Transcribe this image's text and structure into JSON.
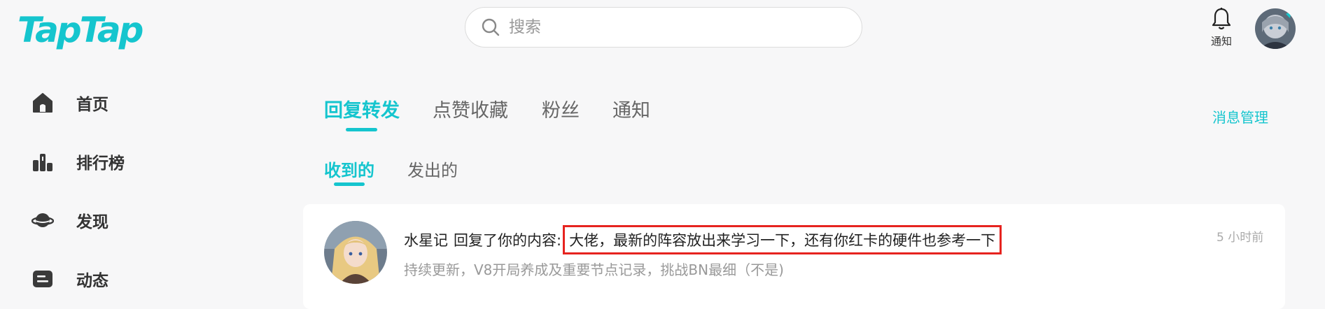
{
  "header": {
    "logo_text": "TapTap",
    "search_placeholder": "搜索",
    "notify_label": "通知"
  },
  "sidebar": {
    "items": [
      {
        "label": "首页",
        "icon": "home-icon"
      },
      {
        "label": "排行榜",
        "icon": "ranking-icon"
      },
      {
        "label": "发现",
        "icon": "planet-icon"
      },
      {
        "label": "动态",
        "icon": "feed-icon"
      }
    ]
  },
  "tabs": [
    {
      "label": "回复转发",
      "active": true
    },
    {
      "label": "点赞收藏",
      "active": false
    },
    {
      "label": "粉丝",
      "active": false
    },
    {
      "label": "通知",
      "active": false
    }
  ],
  "manage_label": "消息管理",
  "subtabs": [
    {
      "label": "收到的",
      "active": true
    },
    {
      "label": "发出的",
      "active": false
    }
  ],
  "message": {
    "user": "水星记",
    "action": "回复了你的内容:",
    "content": "大佬，最新的阵容放出来学习一下，还有你红卡的硬件也参考一下",
    "time": "5 小时前",
    "subtitle": "持续更新，V8开局养成及重要节点记录，挑战BN最细（不是)"
  },
  "colors": {
    "accent": "#15c5ce",
    "highlight_border": "#e6231f"
  }
}
